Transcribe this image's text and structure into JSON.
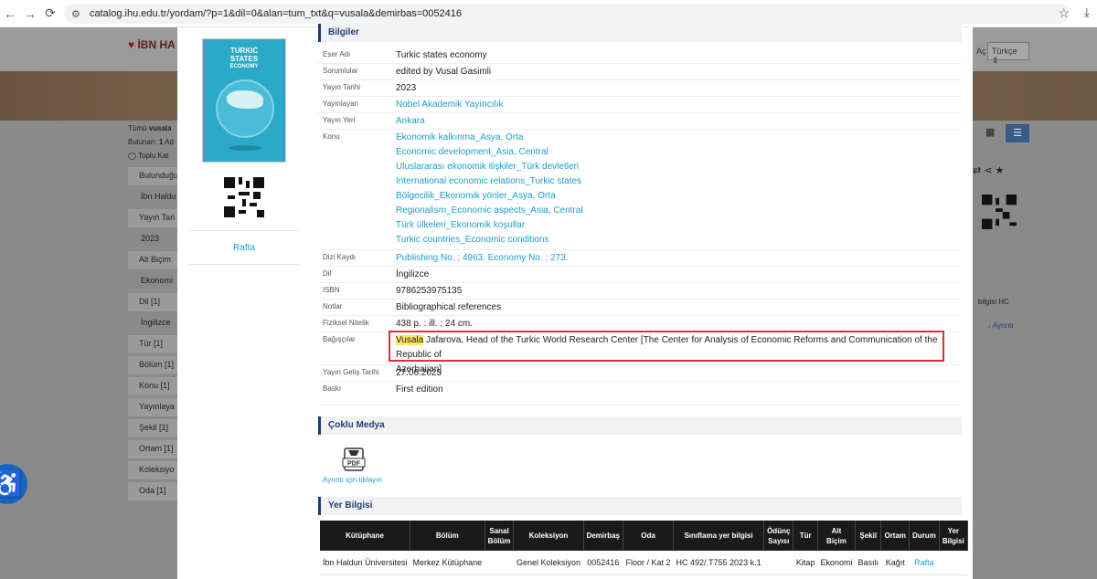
{
  "browser": {
    "url": "catalog.ihu.edu.tr/yordam/?p=1&dil=0&alan=tum_txt&q=vusala&demirbas=0052416"
  },
  "background": {
    "logo_text": "İBN HA",
    "lang_label": "Aç",
    "lang_select": "Türkçe",
    "summary_prefix": "Tümü",
    "summary_query": "vusala",
    "found_label": "Bulunan:",
    "found_count": "1",
    "found_suffix": "Ad",
    "toggle_label": "Toplu Kat",
    "facets": [
      {
        "label": "Bulunduğu",
        "sub": "İbn Haldu"
      },
      {
        "label": "Yayın Tari",
        "sub": "2023"
      },
      {
        "label": "Alt Biçim",
        "sub": "Ekonomi"
      },
      {
        "label": "Dil [1]",
        "sub": "İngilizce"
      },
      {
        "label": "Tür [1]"
      },
      {
        "label": "Bölüm [1]"
      },
      {
        "label": "Konu [1]"
      },
      {
        "label": "Yayınlaya"
      },
      {
        "label": "Şekil [1]"
      },
      {
        "label": "Ortam [1]"
      },
      {
        "label": "Koleksiyo"
      },
      {
        "label": "Oda [1]"
      }
    ],
    "right_yer": "bilgisi HC",
    "right_ayrinti": "Ayrıntı"
  },
  "cover": {
    "title_line1": "TURKIC",
    "title_line2": "STATES",
    "title_line3": "ECONOMY"
  },
  "left": {
    "rafta": "Rafta"
  },
  "bilgiler": {
    "heading": "Bilgiler",
    "rows": {
      "eser_adi": {
        "label": "Eser Adı",
        "value": "Turkic states economy"
      },
      "sorumlular": {
        "label": "Sorumlular",
        "value": "edited by Vusal Gasimli"
      },
      "yayin_tarihi": {
        "label": "Yayın Tarihi",
        "value": "2023"
      },
      "yayinlayan": {
        "label": "Yayınlayan",
        "value": "Nobel Akademik Yayıncılık"
      },
      "yayin_yeri": {
        "label": "Yayın Yeri",
        "value": "Ankara"
      },
      "konu": {
        "label": "Konu",
        "items": [
          "Ekonomik kalkınma_Asya, Orta",
          "Economic development_Asia, Central",
          "Uluslararası ekonomik ilişkiler_Türk devletleri",
          "International economic relations_Turkic states",
          "Bölgecilik_Ekonomik yönler_Asya, Orta",
          "Regionalism_Economic aspects_Asia, Central",
          "Türk ülkeleri_Ekonomik koşullar",
          "Turkic countries_Economic conditions"
        ]
      },
      "dizi_kaydi": {
        "label": "Dizi Kaydı",
        "value": "Publishing No. ; 4963. Economy No. ; 273."
      },
      "dil": {
        "label": "Dil",
        "value": "İngilizce"
      },
      "isbn": {
        "label": "ISBN",
        "value": "9786253975135"
      },
      "notlar": {
        "label": "Notlar",
        "value": "Bibliographical references"
      },
      "fiziksel": {
        "label": "Fiziksel Nitelik",
        "value": "438 p. : ill. ; 24 cm."
      },
      "bagiscilar": {
        "label": "Bağışçılar",
        "highlight": "Vusala",
        "value_line1": " Jafarova, Head of the Turkic World Research Center [The Center for Analysis of Economic Reforms and Communication of the Republic of",
        "value_line2": "Azerbaijan]"
      },
      "yayin_gelis": {
        "label": "Yayın Geliş Tarihi",
        "value": "27.06.2025"
      },
      "baski": {
        "label": "Baskı",
        "value": "First edition"
      }
    }
  },
  "coklu_medya": {
    "heading": "Çoklu Medya",
    "icon_text": "PDF",
    "link": "Ayrıntı için tıklayın"
  },
  "yer_bilgisi": {
    "heading": "Yer Bilgisi",
    "columns": [
      "Kütüphane",
      "Bölüm",
      "Sanal Bölüm",
      "Koleksiyon",
      "Demirbaş",
      "Oda",
      "Sınıflama yer bilgisi",
      "Ödünç Sayısı",
      "Tür",
      "Alt Biçim",
      "Şekil",
      "Ortam",
      "Durum",
      "Yer Bilgisi"
    ],
    "row": [
      "İbn Haldun Üniversitesi",
      "Merkez Kütüphane",
      "",
      "Genel Koleksiyon",
      "0052416",
      "Floor / Kat 2",
      "HC 492/.T755 2023 k.1",
      "",
      "Kitap",
      "Ekonomi",
      "Basılı",
      "Kağıt",
      "Rafta",
      ""
    ]
  }
}
